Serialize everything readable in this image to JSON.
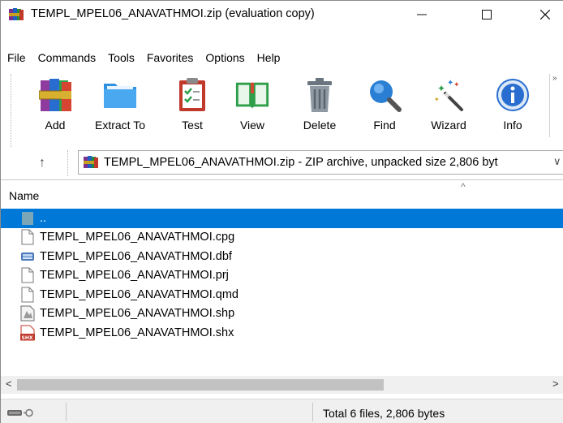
{
  "window": {
    "title": "TEMPL_MPEL06_ANAVATHMOI.zip (evaluation copy)",
    "controls": {
      "minimize": "—",
      "maximize": "☐",
      "close": "✕"
    }
  },
  "menu": {
    "items": [
      "File",
      "Commands",
      "Tools",
      "Favorites",
      "Options",
      "Help"
    ]
  },
  "toolbar": {
    "tools": [
      {
        "label": "Add",
        "icon": "archive-books-icon"
      },
      {
        "label": "Extract To",
        "icon": "folder-icon"
      },
      {
        "label": "Test",
        "icon": "clipboard-check-icon"
      },
      {
        "label": "View",
        "icon": "book-icon"
      },
      {
        "label": "Delete",
        "icon": "trash-icon"
      },
      {
        "label": "Find",
        "icon": "magnifier-icon"
      },
      {
        "label": "Wizard",
        "icon": "magic-wand-icon"
      },
      {
        "label": "Info",
        "icon": "info-icon"
      }
    ],
    "overflow": "»"
  },
  "address": {
    "up": "↑",
    "text": "TEMPL_MPEL06_ANAVATHMOI.zip - ZIP archive, unpacked size 2,806 byt",
    "dropdown": "∨"
  },
  "list": {
    "column_name": "Name",
    "sort_indicator": "^",
    "rows": [
      {
        "name": "..",
        "icon": "parent-folder-icon",
        "selected": true
      },
      {
        "name": "TEMPL_MPEL06_ANAVATHMOI.cpg",
        "icon": "blank-file-icon",
        "selected": false
      },
      {
        "name": "TEMPL_MPEL06_ANAVATHMOI.dbf",
        "icon": "database-file-icon",
        "selected": false
      },
      {
        "name": "TEMPL_MPEL06_ANAVATHMOI.prj",
        "icon": "blank-file-icon",
        "selected": false
      },
      {
        "name": "TEMPL_MPEL06_ANAVATHMOI.qmd",
        "icon": "blank-file-icon",
        "selected": false
      },
      {
        "name": "TEMPL_MPEL06_ANAVATHMOI.shp",
        "icon": "shp-file-icon",
        "selected": false
      },
      {
        "name": "TEMPL_MPEL06_ANAVATHMOI.shx",
        "icon": "shx-file-icon",
        "selected": false
      }
    ]
  },
  "scrollbar": {
    "left": "<",
    "right": ">"
  },
  "status": {
    "text": "Total 6 files, 2,806 bytes"
  },
  "colors": {
    "selection": "#0078d7",
    "background": "#ffffff"
  }
}
